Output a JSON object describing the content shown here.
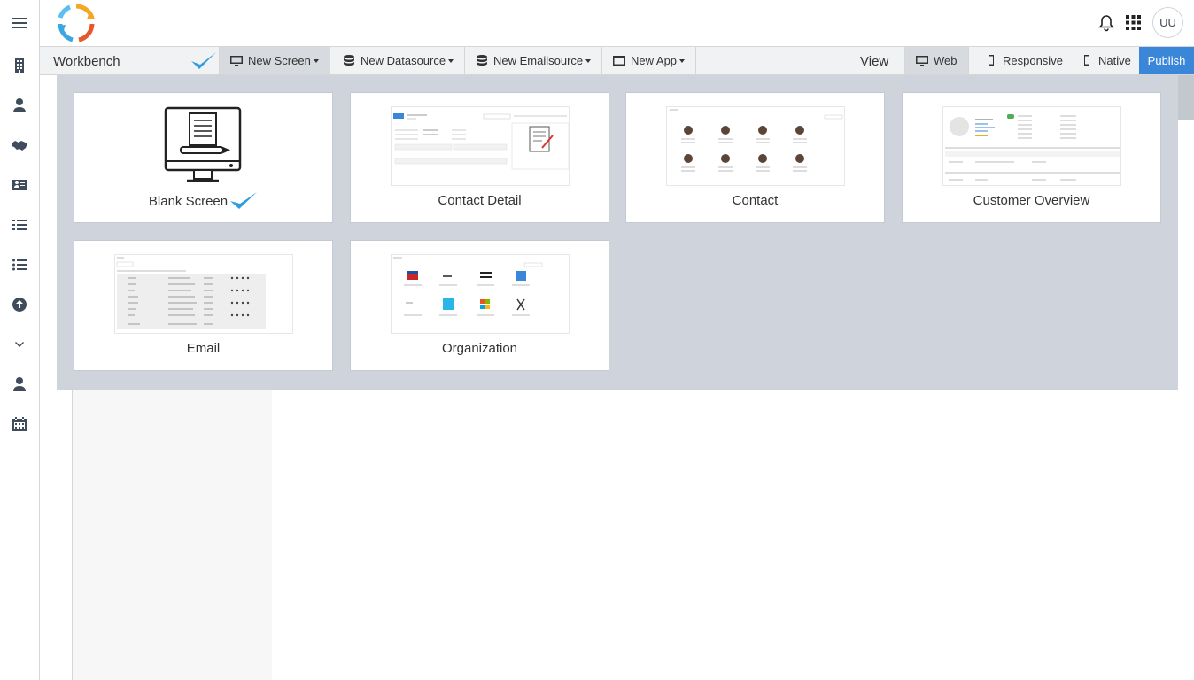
{
  "header": {
    "avatar_initials": "UU"
  },
  "toolbar": {
    "workbench_label": "Workbench",
    "new_screen": "New Screen",
    "new_datasource": "New Datasource",
    "new_emailsource": "New Emailsource",
    "new_app": "New App",
    "view_label": "View",
    "web": "Web",
    "responsive": "Responsive",
    "native": "Native",
    "publish": "Publish"
  },
  "templates": [
    {
      "label": "Blank Screen",
      "selected": true
    },
    {
      "label": "Contact Detail"
    },
    {
      "label": "Contact"
    },
    {
      "label": "Customer Overview"
    },
    {
      "label": "Email"
    },
    {
      "label": "Organization"
    }
  ],
  "colors": {
    "accent": "#3a86d9",
    "check": "#2f9be0",
    "overlay": "#cfd4dc",
    "icon": "#3e4c5c"
  },
  "icons": {
    "rail": [
      "hamburger-icon",
      "building-icon",
      "user-icon",
      "handshake-icon",
      "contact-card-icon",
      "list-icon",
      "list-icon",
      "upload-icon",
      "chevron-down-icon",
      "user-icon",
      "calendar-icon"
    ]
  }
}
